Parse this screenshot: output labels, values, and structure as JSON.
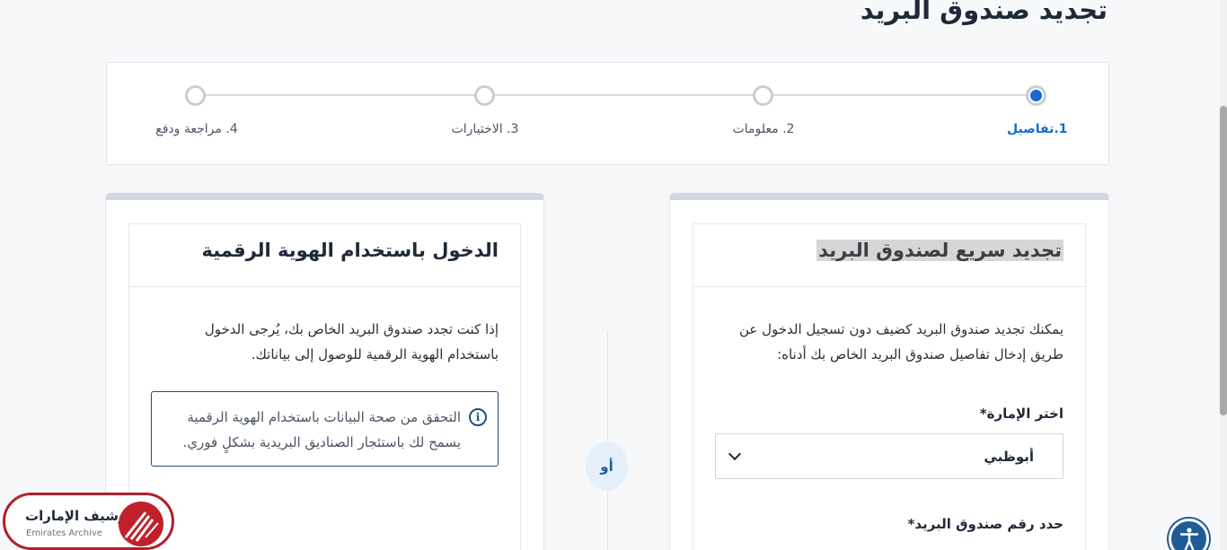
{
  "page_title": "تجديد صندوق البريد",
  "stepper": {
    "steps": [
      {
        "label": "1.تفاصيل",
        "active": true
      },
      {
        "label": "2. معلومات",
        "active": false
      },
      {
        "label": "3. الاختيارات",
        "active": false
      },
      {
        "label": "4. مراجعة ودفع",
        "active": false
      }
    ]
  },
  "quick_renewal": {
    "title": "تجديد سريع لصندوق البريد",
    "description": "يمكنك تجديد صندوق البريد كضيف دون تسجيل الدخول عن طريق إدخال تفاصيل صندوق البريد الخاص بك أدناه:",
    "emirate_label": "اختر الإمارة*",
    "emirate_value": "أبوظبي",
    "pobox_label": "حدد رقم صندوق البريد*"
  },
  "separator": {
    "label": "أو"
  },
  "digital_id": {
    "title": "الدخول باستخدام الهوية الرقمية",
    "description": "إذا كنت تجدد صندوق البريد الخاص بك، يُرجى الدخول باستخدام الهوية الرقمية للوصول إلى بياناتك.",
    "info_text": "التحقق من صحة البيانات باستخدام الهوية الرقمية يسمح لك باستئجار الصناديق البريدية بشكلٍ فوري."
  },
  "watermark": {
    "arabic": "أرشيف الإمارات",
    "english": "Emirates Archive"
  },
  "colors": {
    "accent": "#1769d1",
    "brand_dark": "#1f5b94",
    "watermark_red": "#b01f2a"
  },
  "icons": {
    "info": "info-icon",
    "chevron": "chevron-down-icon",
    "accessibility": "accessibility-icon"
  }
}
